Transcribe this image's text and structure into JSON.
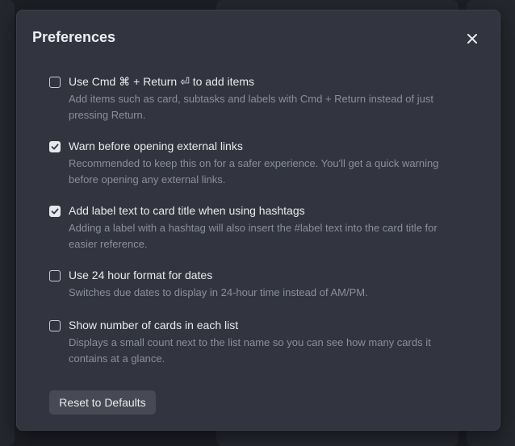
{
  "dialog": {
    "title": "Preferences",
    "close_icon": "close-icon"
  },
  "preferences": [
    {
      "id": "cmd-return",
      "checked": false,
      "label": "Use Cmd ⌘ + Return ⏎ to add items",
      "description": "Add items such as card, subtasks and labels with Cmd + Return instead of just pressing Return."
    },
    {
      "id": "warn-external",
      "checked": true,
      "label": "Warn before opening external links",
      "description": "Recommended to keep this on for a safer experience. You'll get a quick warning before opening any external links."
    },
    {
      "id": "label-hashtags",
      "checked": true,
      "label": "Add label text to card title when using hashtags",
      "description": "Adding a label with a hashtag will also insert the #label text into the card title for easier reference."
    },
    {
      "id": "24-hour",
      "checked": false,
      "label": "Use 24 hour format for dates",
      "description": "Switches due dates to display in 24-hour time instead of AM/PM."
    },
    {
      "id": "card-count",
      "checked": false,
      "label": "Show number of cards in each list",
      "description": "Displays a small count next to the list name so you can see how many cards it contains at a glance."
    }
  ],
  "reset_button": {
    "label": "Reset to Defaults"
  },
  "colors": {
    "modal_bg": "#32353f",
    "backdrop": "#1c1e23",
    "button_bg": "#474a55"
  }
}
